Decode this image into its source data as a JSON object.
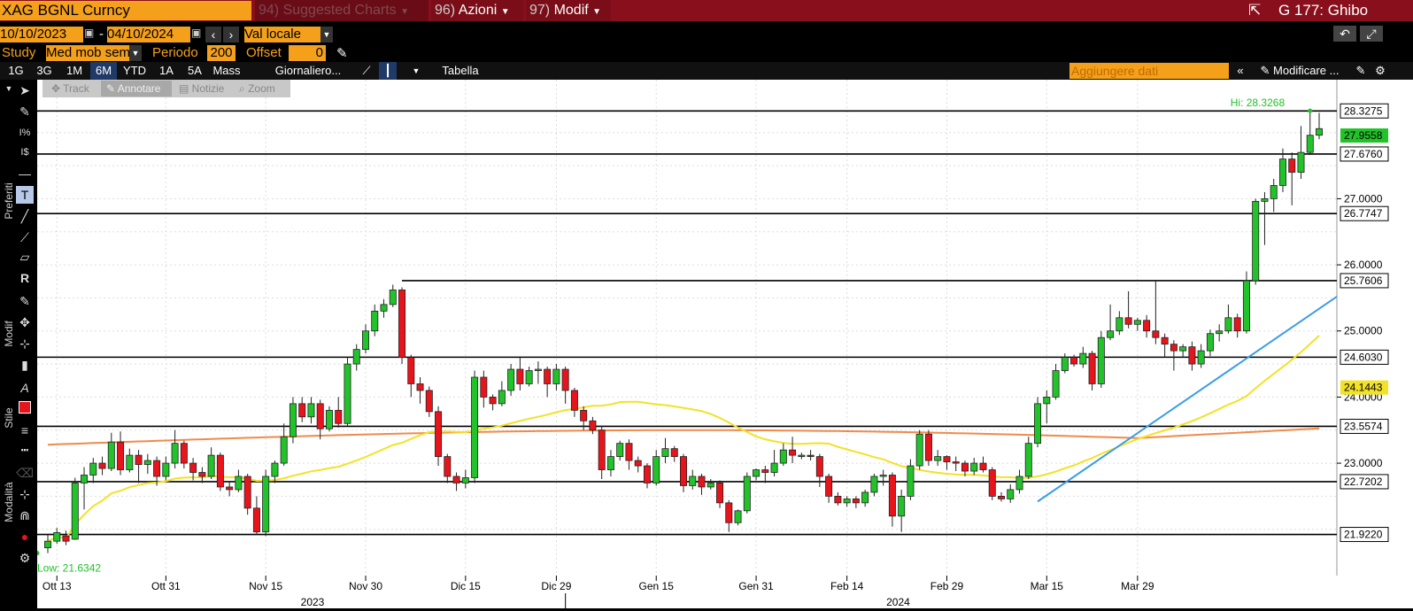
{
  "header": {
    "ticker": "XAG BGNL Curncy",
    "menu1_num": "94)",
    "menu1": "Suggested Charts",
    "menu2_num": "96)",
    "menu2": "Azioni",
    "menu3_num": "97)",
    "menu3": "Modif",
    "right_title": "G 177: Ghibo"
  },
  "daterow": {
    "start": "10/10/2023",
    "sep": "-",
    "end": "04/10/2024",
    "currency": "Val locale"
  },
  "studyrow": {
    "study_label": "Study",
    "study_value": "Med mob sem",
    "period_label": "Periodo",
    "period_value": "200",
    "offset_label": "Offset",
    "offset_value": "0"
  },
  "toolbar": {
    "ranges": [
      "1G",
      "3G",
      "1M",
      "6M",
      "YTD",
      "1A",
      "5A",
      "Mass"
    ],
    "active_range": "6M",
    "frequency": "Giornaliero...",
    "table": "Tabella",
    "add_data_placeholder": "Aggiungere dati",
    "modify": "Modificare ..."
  },
  "modebar": {
    "track": "Track",
    "annotate": "Annotare",
    "news": "Notizie",
    "zoom": "Zoom"
  },
  "leftpanel": {
    "preferiti": "Preferiti",
    "modif": "Modif",
    "stile": "Stile",
    "modalita": "Modalità"
  },
  "colors": {
    "up": "#22c22a",
    "down": "#e8141c",
    "ma_yellow": "#f2e228",
    "ma_orange": "#f08a4b",
    "trend": "#3a9de8",
    "accent": "#f5a01a"
  },
  "chart_data": {
    "type": "candlestick",
    "x_labels": [
      "Ott 13",
      "Ott 31",
      "Nov 15",
      "Nov 30",
      "Dic 15",
      "Dic 29",
      "Gen 15",
      "Gen 31",
      "Feb 14",
      "Feb 29",
      "Mar 15",
      "Mar 29"
    ],
    "years": [
      "2023",
      "2024"
    ],
    "y_ticks": [
      "23.0000",
      "24.0000",
      "25.0000",
      "26.0000",
      "27.0000"
    ],
    "ylim": [
      21.3,
      28.8
    ],
    "hi_label": "Hi: 28.3268",
    "low_label": "Low: 21.6342",
    "last_price": "27.9558",
    "level_lines": [
      "28.3275",
      "27.6760",
      "26.7747",
      "25.7606",
      "24.6030",
      "23.5574",
      "22.7202",
      "21.9220"
    ],
    "ma_labels": [
      "24.1443"
    ],
    "candles": [
      [
        21.72,
        21.82,
        21.64,
        21.92
      ],
      [
        21.82,
        21.95,
        21.78,
        22.02
      ],
      [
        21.9,
        21.82,
        21.76,
        21.98
      ],
      [
        21.85,
        22.7,
        21.84,
        22.78
      ],
      [
        22.7,
        22.82,
        22.3,
        22.94
      ],
      [
        22.82,
        23.0,
        22.7,
        23.08
      ],
      [
        23.0,
        22.92,
        22.82,
        23.1
      ],
      [
        22.92,
        23.32,
        22.88,
        23.46
      ],
      [
        23.32,
        22.9,
        22.82,
        23.48
      ],
      [
        22.9,
        23.12,
        22.86,
        23.22
      ],
      [
        23.12,
        22.98,
        22.7,
        23.2
      ],
      [
        22.98,
        23.04,
        22.84,
        23.14
      ],
      [
        23.04,
        22.8,
        22.66,
        23.1
      ],
      [
        22.8,
        23.0,
        22.74,
        23.1
      ],
      [
        23.0,
        23.3,
        22.92,
        23.5
      ],
      [
        23.3,
        23.0,
        22.92,
        23.34
      ],
      [
        23.0,
        22.86,
        22.74,
        23.08
      ],
      [
        22.86,
        22.8,
        22.7,
        22.94
      ],
      [
        22.8,
        23.12,
        22.76,
        23.24
      ],
      [
        23.12,
        22.64,
        22.58,
        23.16
      ],
      [
        22.64,
        22.6,
        22.5,
        22.72
      ],
      [
        22.6,
        22.8,
        22.56,
        22.9
      ],
      [
        22.8,
        22.32,
        22.22,
        22.84
      ],
      [
        22.32,
        21.96,
        21.92,
        22.5
      ],
      [
        21.96,
        22.8,
        21.9,
        22.9
      ],
      [
        22.8,
        23.0,
        22.7,
        23.04
      ],
      [
        23.0,
        23.4,
        22.96,
        23.6
      ],
      [
        23.4,
        23.9,
        23.3,
        24.0
      ],
      [
        23.9,
        23.7,
        23.62,
        24.0
      ],
      [
        23.7,
        23.9,
        23.6,
        24.0
      ],
      [
        23.9,
        23.52,
        23.36,
        23.96
      ],
      [
        23.52,
        23.8,
        23.48,
        23.86
      ],
      [
        23.8,
        23.6,
        23.54,
        24.0
      ],
      [
        23.6,
        24.5,
        23.56,
        24.6
      ],
      [
        24.5,
        24.72,
        24.4,
        24.8
      ],
      [
        24.72,
        25.0,
        24.66,
        25.1
      ],
      [
        25.0,
        25.3,
        24.92,
        25.4
      ],
      [
        25.3,
        25.4,
        25.2,
        25.48
      ],
      [
        25.4,
        25.62,
        25.36,
        25.7
      ],
      [
        25.62,
        24.6,
        24.5,
        25.66
      ],
      [
        24.6,
        24.2,
        24.0,
        24.64
      ],
      [
        24.2,
        24.1,
        23.9,
        24.3
      ],
      [
        24.1,
        23.78,
        23.7,
        24.16
      ],
      [
        23.78,
        23.1,
        22.96,
        23.86
      ],
      [
        23.1,
        22.8,
        22.7,
        23.14
      ],
      [
        22.8,
        22.7,
        22.58,
        22.86
      ],
      [
        22.7,
        22.78,
        22.62,
        22.9
      ],
      [
        22.78,
        24.3,
        22.7,
        24.4
      ],
      [
        24.3,
        24.0,
        23.84,
        24.4
      ],
      [
        24.0,
        23.9,
        23.8,
        24.04
      ],
      [
        23.9,
        24.1,
        23.86,
        24.24
      ],
      [
        24.1,
        24.42,
        24.02,
        24.5
      ],
      [
        24.42,
        24.2,
        24.1,
        24.6
      ],
      [
        24.2,
        24.4,
        24.16,
        24.46
      ],
      [
        24.4,
        24.42,
        24.2,
        24.54
      ],
      [
        24.42,
        24.2,
        24.0,
        24.46
      ],
      [
        24.2,
        24.42,
        24.1,
        24.5
      ],
      [
        24.42,
        24.1,
        23.9,
        24.46
      ],
      [
        24.1,
        23.8,
        23.7,
        24.14
      ],
      [
        23.8,
        23.64,
        23.5,
        23.86
      ],
      [
        23.64,
        23.5,
        23.44,
        23.7
      ],
      [
        23.5,
        22.9,
        22.76,
        23.56
      ],
      [
        22.9,
        23.1,
        22.8,
        23.2
      ],
      [
        23.1,
        23.3,
        23.04,
        23.34
      ],
      [
        23.3,
        23.04,
        22.9,
        23.36
      ],
      [
        23.04,
        22.96,
        22.86,
        23.1
      ],
      [
        22.96,
        22.7,
        22.62,
        23.0
      ],
      [
        22.7,
        23.1,
        22.66,
        23.2
      ],
      [
        23.1,
        23.22,
        23.0,
        23.38
      ],
      [
        23.22,
        23.1,
        23.02,
        23.26
      ],
      [
        23.1,
        22.66,
        22.56,
        23.14
      ],
      [
        22.66,
        22.8,
        22.6,
        22.9
      ],
      [
        22.8,
        22.64,
        22.52,
        22.84
      ],
      [
        22.64,
        22.7,
        22.6,
        22.76
      ],
      [
        22.7,
        22.4,
        22.32,
        22.74
      ],
      [
        22.4,
        22.1,
        21.96,
        22.44
      ],
      [
        22.1,
        22.28,
        22.06,
        22.3
      ],
      [
        22.28,
        22.8,
        22.24,
        22.86
      ],
      [
        22.8,
        22.9,
        22.74,
        22.92
      ],
      [
        22.9,
        22.86,
        22.7,
        22.96
      ],
      [
        22.86,
        23.0,
        22.8,
        23.2
      ],
      [
        23.0,
        23.2,
        22.96,
        23.3
      ],
      [
        23.2,
        23.12,
        23.0,
        23.4
      ],
      [
        23.12,
        23.12,
        23.06,
        23.16
      ],
      [
        23.12,
        23.1,
        23.04,
        23.2
      ],
      [
        23.1,
        22.8,
        22.64,
        23.14
      ],
      [
        22.8,
        22.5,
        22.4,
        22.84
      ],
      [
        22.5,
        22.4,
        22.36,
        22.56
      ],
      [
        22.4,
        22.46,
        22.34,
        22.5
      ],
      [
        22.46,
        22.4,
        22.32,
        22.5
      ],
      [
        22.4,
        22.56,
        22.34,
        22.6
      ],
      [
        22.56,
        22.8,
        22.5,
        22.84
      ],
      [
        22.8,
        22.82,
        22.66,
        22.9
      ],
      [
        22.82,
        22.2,
        22.04,
        22.86
      ],
      [
        22.2,
        22.5,
        21.96,
        22.6
      ],
      [
        22.5,
        22.96,
        22.44,
        23.06
      ],
      [
        22.96,
        23.44,
        22.9,
        23.5
      ],
      [
        23.44,
        23.04,
        22.96,
        23.5
      ],
      [
        23.04,
        23.1,
        22.96,
        23.2
      ],
      [
        23.1,
        23.02,
        22.9,
        23.12
      ],
      [
        23.02,
        23.0,
        22.88,
        23.1
      ],
      [
        23.0,
        22.88,
        22.8,
        23.04
      ],
      [
        22.88,
        23.0,
        22.82,
        23.08
      ],
      [
        23.0,
        22.9,
        22.86,
        23.1
      ],
      [
        22.9,
        22.5,
        22.44,
        22.94
      ],
      [
        22.5,
        22.46,
        22.42,
        22.56
      ],
      [
        22.46,
        22.6,
        22.4,
        22.68
      ],
      [
        22.6,
        22.8,
        22.54,
        22.9
      ],
      [
        22.8,
        23.3,
        22.76,
        23.4
      ],
      [
        23.3,
        23.9,
        23.24,
        24.0
      ],
      [
        23.9,
        24.0,
        23.6,
        24.1
      ],
      [
        24.0,
        24.4,
        23.96,
        24.5
      ],
      [
        24.4,
        24.6,
        24.36,
        24.66
      ],
      [
        24.6,
        24.5,
        24.46,
        24.64
      ],
      [
        24.5,
        24.66,
        24.44,
        24.76
      ],
      [
        24.66,
        24.2,
        24.1,
        24.7
      ],
      [
        24.2,
        24.9,
        24.14,
        25.0
      ],
      [
        24.9,
        25.0,
        24.86,
        25.4
      ],
      [
        25.0,
        25.2,
        24.94,
        25.3
      ],
      [
        25.2,
        25.1,
        25.04,
        25.6
      ],
      [
        25.1,
        25.16,
        25.0,
        25.2
      ],
      [
        25.16,
        25.0,
        24.9,
        25.24
      ],
      [
        25.0,
        24.9,
        24.8,
        25.76
      ],
      [
        24.9,
        24.8,
        24.6,
        24.96
      ],
      [
        24.8,
        24.7,
        24.4,
        24.86
      ],
      [
        24.7,
        24.76,
        24.6,
        24.8
      ],
      [
        24.76,
        24.5,
        24.4,
        24.84
      ],
      [
        24.5,
        24.7,
        24.44,
        24.8
      ],
      [
        24.7,
        24.96,
        24.62,
        25.02
      ],
      [
        24.96,
        25.0,
        24.84,
        25.1
      ],
      [
        25.0,
        25.2,
        24.96,
        25.4
      ],
      [
        25.2,
        25.0,
        24.9,
        25.26
      ],
      [
        25.0,
        25.76,
        24.96,
        25.9
      ],
      [
        25.76,
        26.96,
        25.7,
        27.0
      ],
      [
        26.96,
        27.0,
        26.3,
        27.1
      ],
      [
        27.0,
        27.2,
        26.8,
        27.3
      ],
      [
        27.2,
        27.6,
        27.1,
        27.76
      ],
      [
        27.6,
        27.4,
        26.9,
        27.7
      ],
      [
        27.4,
        27.7,
        27.3,
        28.1
      ],
      [
        27.7,
        27.96,
        27.66,
        28.33
      ],
      [
        27.96,
        28.06,
        27.9,
        28.3
      ]
    ]
  }
}
